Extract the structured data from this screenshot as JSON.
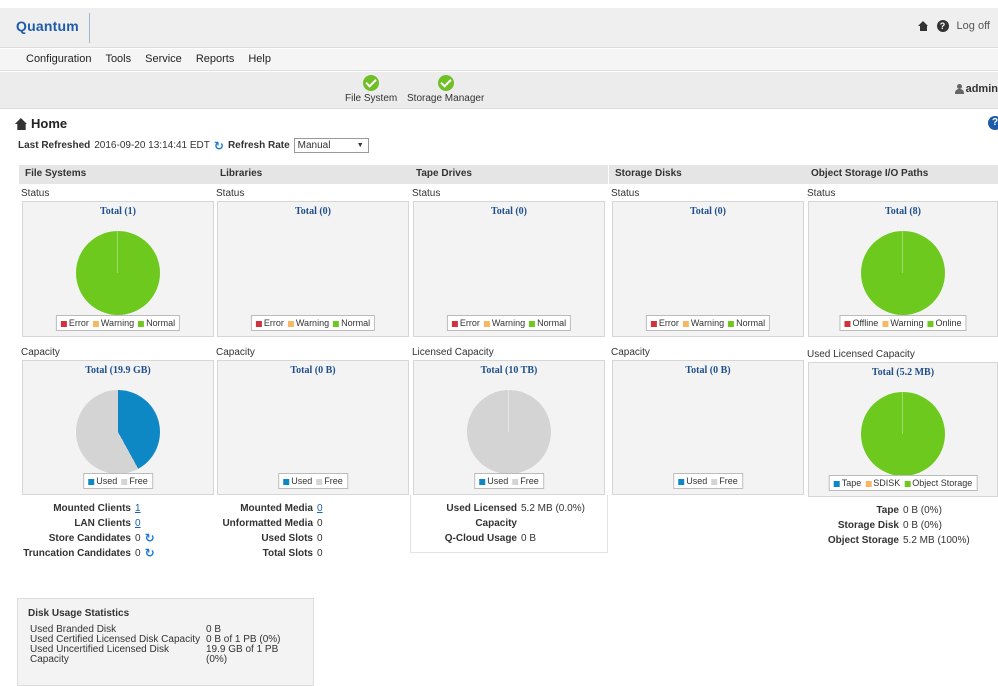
{
  "header": {
    "logo": "Quantum",
    "log_off": "Log off",
    "help_icon": "?"
  },
  "menu": [
    "Configuration",
    "Tools",
    "Service",
    "Reports",
    "Help"
  ],
  "status": {
    "items": [
      {
        "label": "File System"
      },
      {
        "label": "Storage Manager"
      }
    ],
    "user": "admin"
  },
  "page": {
    "title": "Home",
    "help": "?"
  },
  "refresh": {
    "last_label": "Last Refreshed",
    "last_value": "2016-09-20 13:14:41 EDT",
    "rate_label": "Refresh Rate",
    "rate_value": "Manual"
  },
  "colors": {
    "green": "#6ec91f",
    "blue": "#0e88c4",
    "grey": "#d4d4d4",
    "red": "#d0333d",
    "orange": "#f6b862"
  },
  "panels": {
    "fs": {
      "title": "File Systems",
      "status_label": "Status",
      "status_total": "Total (1)",
      "status_legend": [
        "Error",
        "Warning",
        "Normal"
      ],
      "cap_label": "Capacity",
      "cap_total": "Total (19.9 GB)",
      "cap_legend": [
        "Used",
        "Free"
      ],
      "stats": [
        {
          "label": "Mounted Clients",
          "value": "1"
        },
        {
          "label": "LAN Clients",
          "value": "0"
        },
        {
          "label": "Store Candidates",
          "value": "0"
        },
        {
          "label": "Truncation Candidates",
          "value": "0"
        }
      ]
    },
    "lib": {
      "title": "Libraries",
      "status_label": "Status",
      "status_total": "Total (0)",
      "status_legend": [
        "Error",
        "Warning",
        "Normal"
      ],
      "cap_label": "Capacity",
      "cap_total": "Total (0 B)",
      "cap_legend": [
        "Used",
        "Free"
      ],
      "stats": [
        {
          "label": "Mounted Media",
          "value": "0"
        },
        {
          "label": "Unformatted Media",
          "value": "0"
        },
        {
          "label": "Used Slots",
          "value": "0"
        },
        {
          "label": "Total Slots",
          "value": "0"
        }
      ]
    },
    "tape": {
      "title": "Tape Drives",
      "status_label": "Status",
      "status_total": "Total (0)",
      "status_legend": [
        "Error",
        "Warning",
        "Normal"
      ],
      "cap_label": "Licensed Capacity",
      "cap_total": "Total (10 TB)",
      "cap_legend": [
        "Used",
        "Free"
      ],
      "stats": [
        {
          "label": "Used Licensed Capacity",
          "value": "5.2 MB (0.0%)"
        },
        {
          "label": "Q-Cloud Usage",
          "value": "0 B"
        }
      ]
    },
    "disk": {
      "title": "Storage Disks",
      "status_label": "Status",
      "status_total": "Total (0)",
      "status_legend": [
        "Error",
        "Warning",
        "Normal"
      ],
      "cap_label": "Capacity",
      "cap_total": "Total (0 B)",
      "cap_legend": [
        "Used",
        "Free"
      ]
    },
    "obj": {
      "title": "Object Storage I/O Paths",
      "status_label": "Status",
      "status_total": "Total (8)",
      "status_legend": [
        "Offline",
        "Warning",
        "Online"
      ],
      "cap_label": "Used Licensed Capacity",
      "cap_total": "Total (5.2 MB)",
      "cap_legend": [
        "Tape",
        "SDISK",
        "Object Storage"
      ],
      "stats": [
        {
          "label": "Tape",
          "value": "0 B (0%)"
        },
        {
          "label": "Storage Disk",
          "value": "0 B (0%)"
        },
        {
          "label": "Object Storage",
          "value": "5.2 MB (100%)"
        }
      ]
    }
  },
  "disk_usage": {
    "title": "Disk Usage Statistics",
    "rows": [
      {
        "label": "Used Branded Disk",
        "value": "0 B"
      },
      {
        "label": "Used Certified Licensed Disk Capacity",
        "value": "0 B of 1 PB (0%)"
      },
      {
        "label": "Used Uncertified Licensed Disk Capacity",
        "value": "19.9 GB of 1 PB (0%)"
      }
    ]
  },
  "chart_data": [
    {
      "type": "pie",
      "title": "Total (1)",
      "categories": [
        "Error",
        "Warning",
        "Normal"
      ],
      "values": [
        0,
        0,
        1
      ]
    },
    {
      "type": "pie",
      "title": "Total (19.9 GB)",
      "categories": [
        "Used",
        "Free"
      ],
      "values": [
        42,
        58
      ]
    },
    {
      "type": "pie",
      "title": "Total (10 TB)",
      "categories": [
        "Used",
        "Free"
      ],
      "values": [
        0,
        100
      ]
    },
    {
      "type": "pie",
      "title": "Total (8)",
      "categories": [
        "Offline",
        "Warning",
        "Online"
      ],
      "values": [
        0,
        0,
        8
      ]
    },
    {
      "type": "pie",
      "title": "Total (5.2 MB)",
      "categories": [
        "Tape",
        "SDISK",
        "Object Storage"
      ],
      "values": [
        0,
        0,
        100
      ]
    }
  ]
}
